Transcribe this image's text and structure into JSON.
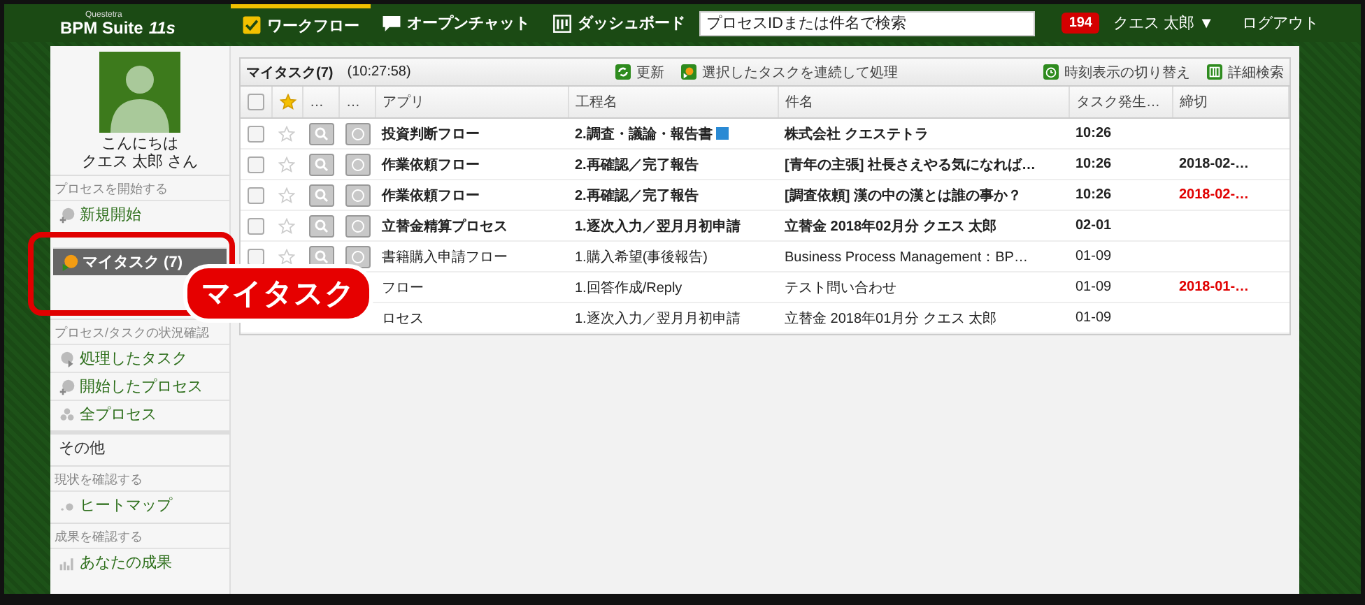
{
  "header": {
    "logo": {
      "maker": "Questetra",
      "name": "BPM Suite",
      "version": "11s"
    },
    "nav": [
      {
        "label": "ワークフロー",
        "selected": true
      },
      {
        "label": "オープンチャット",
        "selected": false
      },
      {
        "label": "ダッシュボード",
        "selected": false
      }
    ],
    "search": {
      "placeholder": "プロセスIDまたは件名で検索"
    },
    "badge": "194",
    "user": "クエス 太郎 ▼",
    "logout": "ログアウト"
  },
  "sidebar": {
    "greeting": "こんにちは",
    "user_line": "クエス 太郎 さん",
    "sections": [
      {
        "label": "プロセスを開始する",
        "items": [
          {
            "label": "新規開始",
            "kind": "new",
            "selected": false
          }
        ]
      },
      {
        "items": [
          {
            "label": "マイタスク (7)",
            "kind": "task",
            "selected": true
          }
        ]
      },
      {
        "label": "プロセス/タスクの状況確認",
        "items": [
          {
            "label": "処理したタスク",
            "kind": "done",
            "selected": false
          },
          {
            "label": "開始したプロセス",
            "kind": "new",
            "selected": false
          },
          {
            "label": "全プロセス",
            "kind": "all",
            "selected": false
          }
        ]
      },
      {
        "items": [
          {
            "label": "その他",
            "kind": "plain",
            "selected": false
          }
        ]
      },
      {
        "label": "現状を確認する",
        "items": [
          {
            "label": "ヒートマップ",
            "kind": "heat",
            "selected": false
          }
        ]
      },
      {
        "label": "成果を確認する",
        "items": [
          {
            "label": "あなたの成果",
            "kind": "bars",
            "selected": false
          }
        ]
      }
    ]
  },
  "panel": {
    "title": "マイタスク(7)",
    "time": "(10:27:58)",
    "actions": [
      {
        "label": "更新"
      },
      {
        "label": "選択したタスクを連続して処理"
      }
    ],
    "right_actions": [
      {
        "label": "時刻表示の切り替え"
      },
      {
        "label": "詳細検索"
      }
    ],
    "select_all_checked": false,
    "columns": [
      "…",
      "…",
      "アプリ",
      "工程名",
      "件名",
      "タスク発生…",
      "締切"
    ],
    "rows": [
      {
        "app": "投資判断フロー",
        "step": "2.調査・議論・報告書",
        "step_icon": true,
        "subject": "株式会社 クエステトラ",
        "occurred": "10:26",
        "unread": true,
        "starred": false,
        "checked": false
      },
      {
        "app": "作業依頼フロー",
        "step": "2.再確認／完了報告",
        "subject": "[青年の主張] 社長さえやる気になれば…",
        "occurred": "10:26",
        "deadline": "2018-02-…",
        "unread": true,
        "overdue": false,
        "starred": false,
        "checked": false
      },
      {
        "app": "作業依頼フロー",
        "step": "2.再確認／完了報告",
        "subject": "[調査依頼] 漢の中の漢とは誰の事か？",
        "occurred": "10:26",
        "deadline": "2018-02-…",
        "unread": true,
        "overdue": true,
        "starred": false,
        "checked": false
      },
      {
        "app": "立替金精算プロセス",
        "step": "1.逐次入力／翌月月初申請",
        "subject": "立替金 2018年02月分 クエス 太郎",
        "occurred": "02-01",
        "unread": true,
        "starred": false,
        "checked": false
      },
      {
        "app": "書籍購入申請フロー",
        "step": "1.購入希望(事後報告)",
        "subject": "Business Process Management：BP…",
        "occurred": "01-09",
        "unread": false,
        "starred": false,
        "checked": false
      },
      {
        "app": "フロー",
        "step": "1.回答作成/Reply",
        "subject": "テスト問い合わせ",
        "occurred": "01-09",
        "deadline": "2018-01-…",
        "unread": false,
        "overdue": true
      },
      {
        "app": "ロセス",
        "step": "1.逐次入力／翌月月初申請",
        "subject": "立替金 2018年01月分 クエス 太郎",
        "occurred": "01-09",
        "unread": false
      }
    ]
  },
  "callout": {
    "label": "マイタスク"
  }
}
